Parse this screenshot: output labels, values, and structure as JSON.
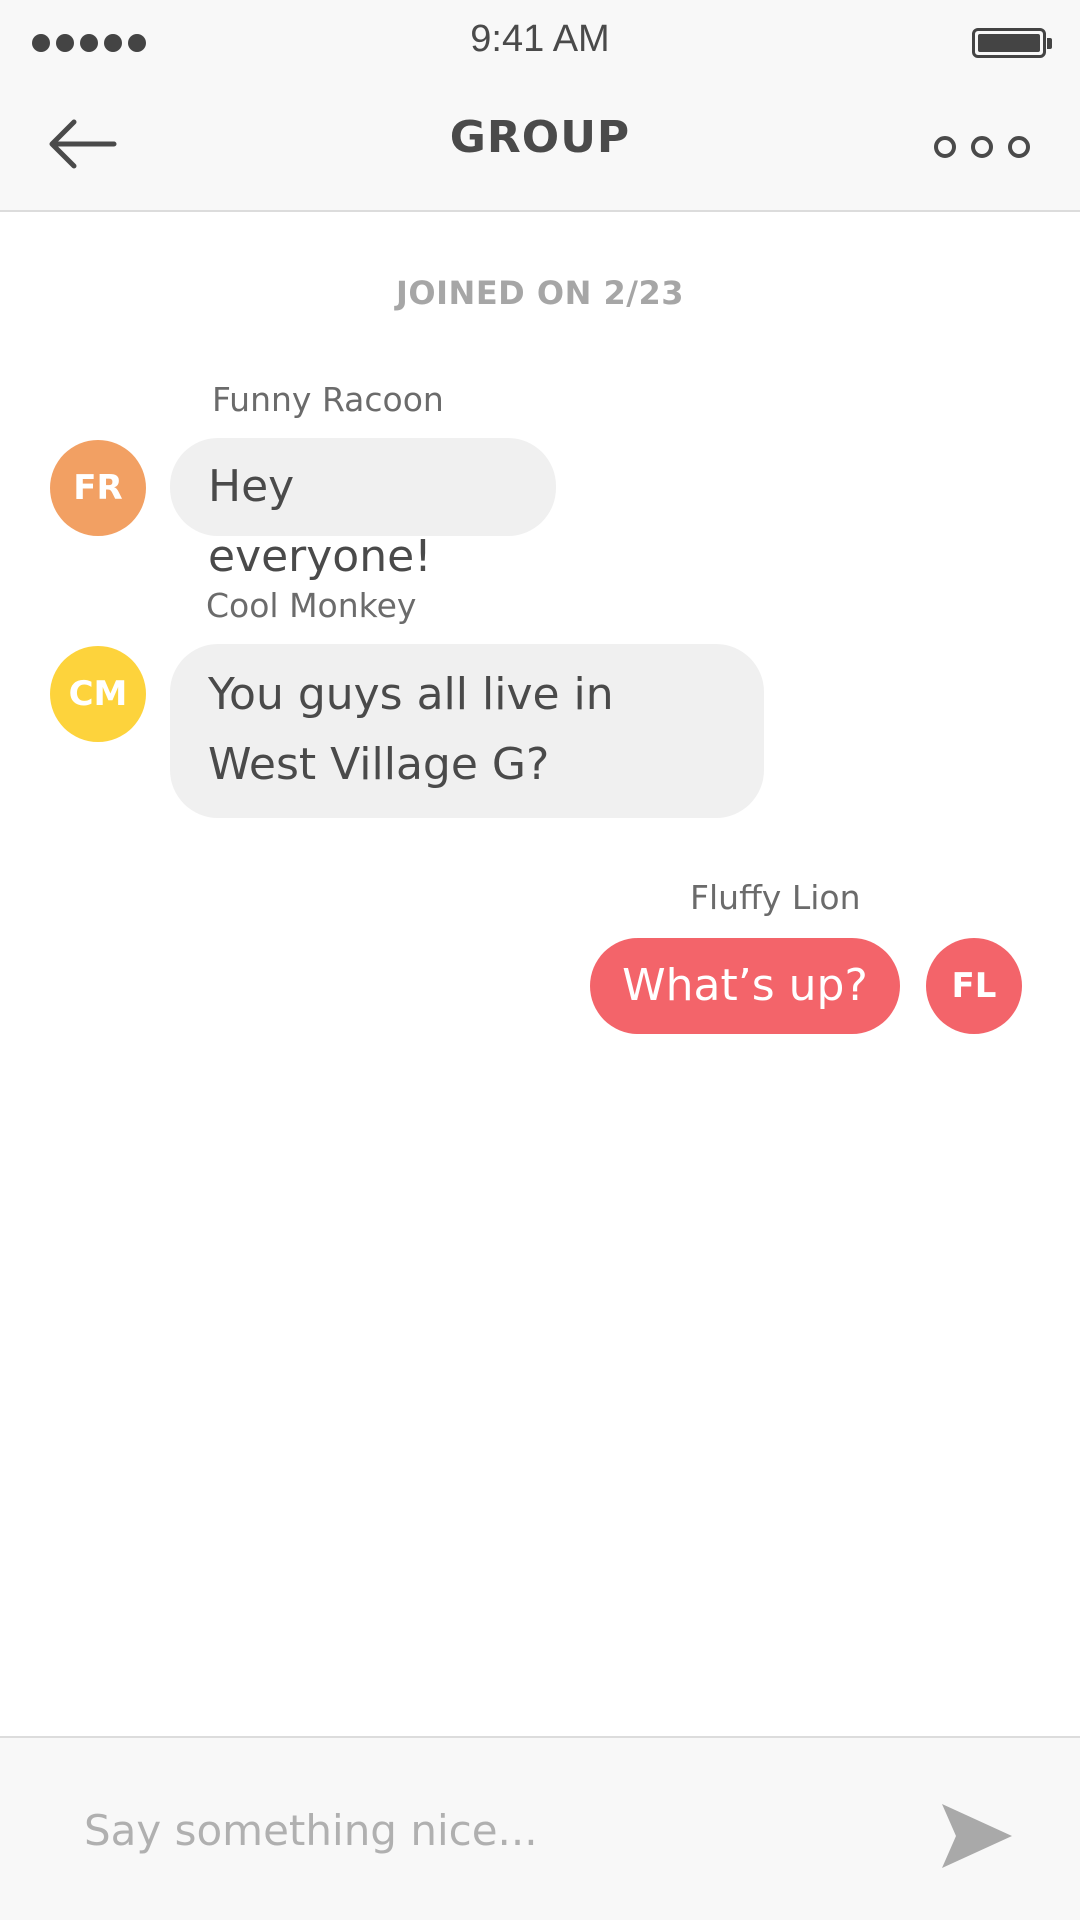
{
  "status_bar": {
    "time": "9:41 AM",
    "signal_icon": "signal-strength-icon",
    "battery_icon": "battery-full-icon"
  },
  "nav": {
    "title": "GROUP",
    "back_icon": "arrow-left-icon",
    "more_icon": "more-options-icon"
  },
  "chat": {
    "joined_note": "JOINED ON 2/23",
    "messages": [
      {
        "sender": "Funny Racoon",
        "initials": "FR",
        "text": "Hey everyone!",
        "avatar_color": "#f2a063",
        "bubble_color": "#f0f0f0",
        "outgoing": false
      },
      {
        "sender": "Cool Monkey",
        "initials": "CM",
        "text": "You guys all live in West Village G?",
        "avatar_color": "#fdd33c",
        "bubble_color": "#f0f0f0",
        "outgoing": false
      },
      {
        "sender": "Fluffy Lion",
        "initials": "FL",
        "text": "What’s up?",
        "avatar_color": "#f3646a",
        "bubble_color": "#f3646a",
        "outgoing": true
      }
    ]
  },
  "compose": {
    "placeholder": "Say something nice...",
    "value": "",
    "send_icon": "send-icon"
  }
}
